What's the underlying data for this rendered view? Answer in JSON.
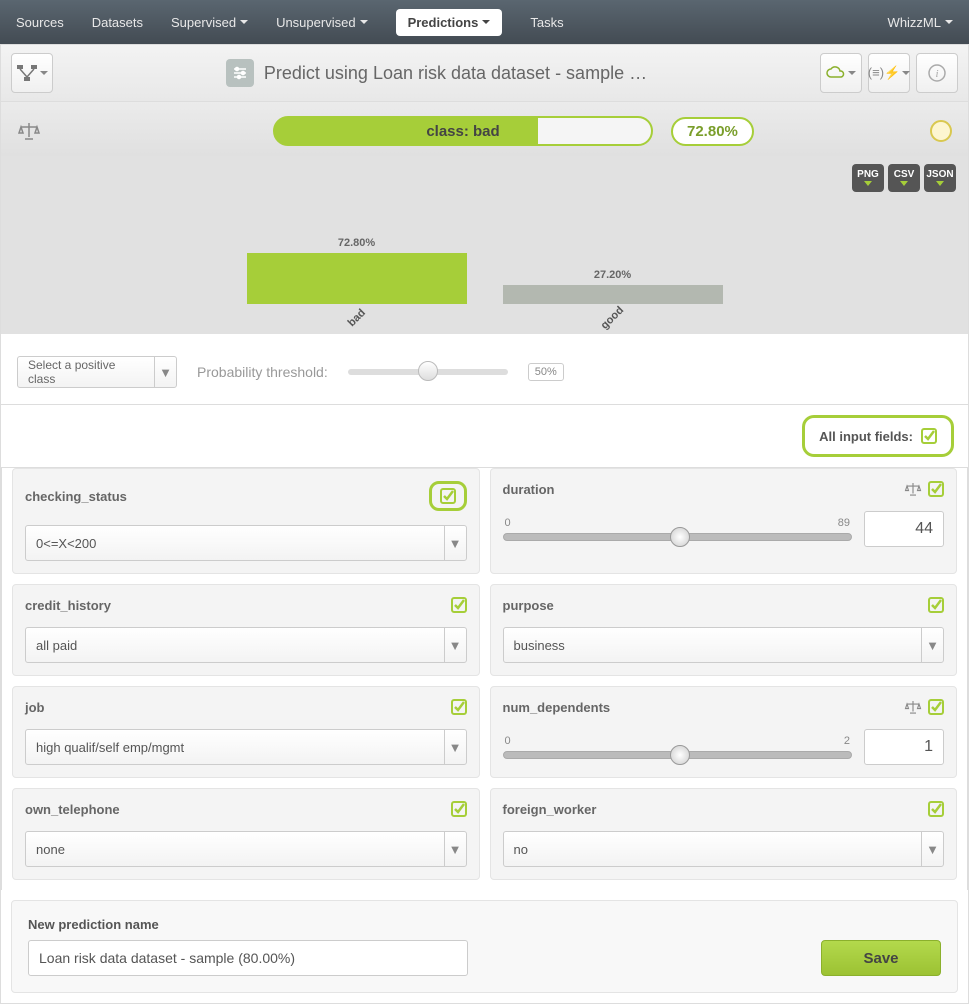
{
  "nav": {
    "sources": "Sources",
    "datasets": "Datasets",
    "supervised": "Supervised",
    "unsupervised": "Unsupervised",
    "predictions": "Predictions",
    "tasks": "Tasks",
    "whizzml": "WhizzML"
  },
  "title": "Predict using Loan risk data dataset - sample …",
  "prediction": {
    "class_label": "class: bad",
    "confidence": "72.80%"
  },
  "chart_data": {
    "type": "bar",
    "categories": [
      "bad",
      "good"
    ],
    "values": [
      72.8,
      27.2
    ],
    "value_labels": [
      "72.80%",
      "27.20%"
    ],
    "ylim": [
      0,
      100
    ]
  },
  "export": {
    "png": "PNG",
    "csv": "CSV",
    "json": "JSON"
  },
  "controls": {
    "positive_class_placeholder": "Select a positive class",
    "prob_threshold_label": "Probability threshold:",
    "prob_threshold_value": "50%"
  },
  "all_input_fields_label": "All input fields:",
  "fields": {
    "checking_status": {
      "label": "checking_status",
      "value": "0<=X<200"
    },
    "duration": {
      "label": "duration",
      "min": "0",
      "max": "89",
      "value": "44"
    },
    "credit_history": {
      "label": "credit_history",
      "value": "all paid"
    },
    "purpose": {
      "label": "purpose",
      "value": "business"
    },
    "job": {
      "label": "job",
      "value": "high qualif/self emp/mgmt"
    },
    "num_dependents": {
      "label": "num_dependents",
      "min": "0",
      "max": "2",
      "value": "1"
    },
    "own_telephone": {
      "label": "own_telephone",
      "value": "none"
    },
    "foreign_worker": {
      "label": "foreign_worker",
      "value": "no"
    }
  },
  "bottom": {
    "label": "New prediction name",
    "value": "Loan risk data dataset - sample (80.00%)",
    "save": "Save"
  }
}
